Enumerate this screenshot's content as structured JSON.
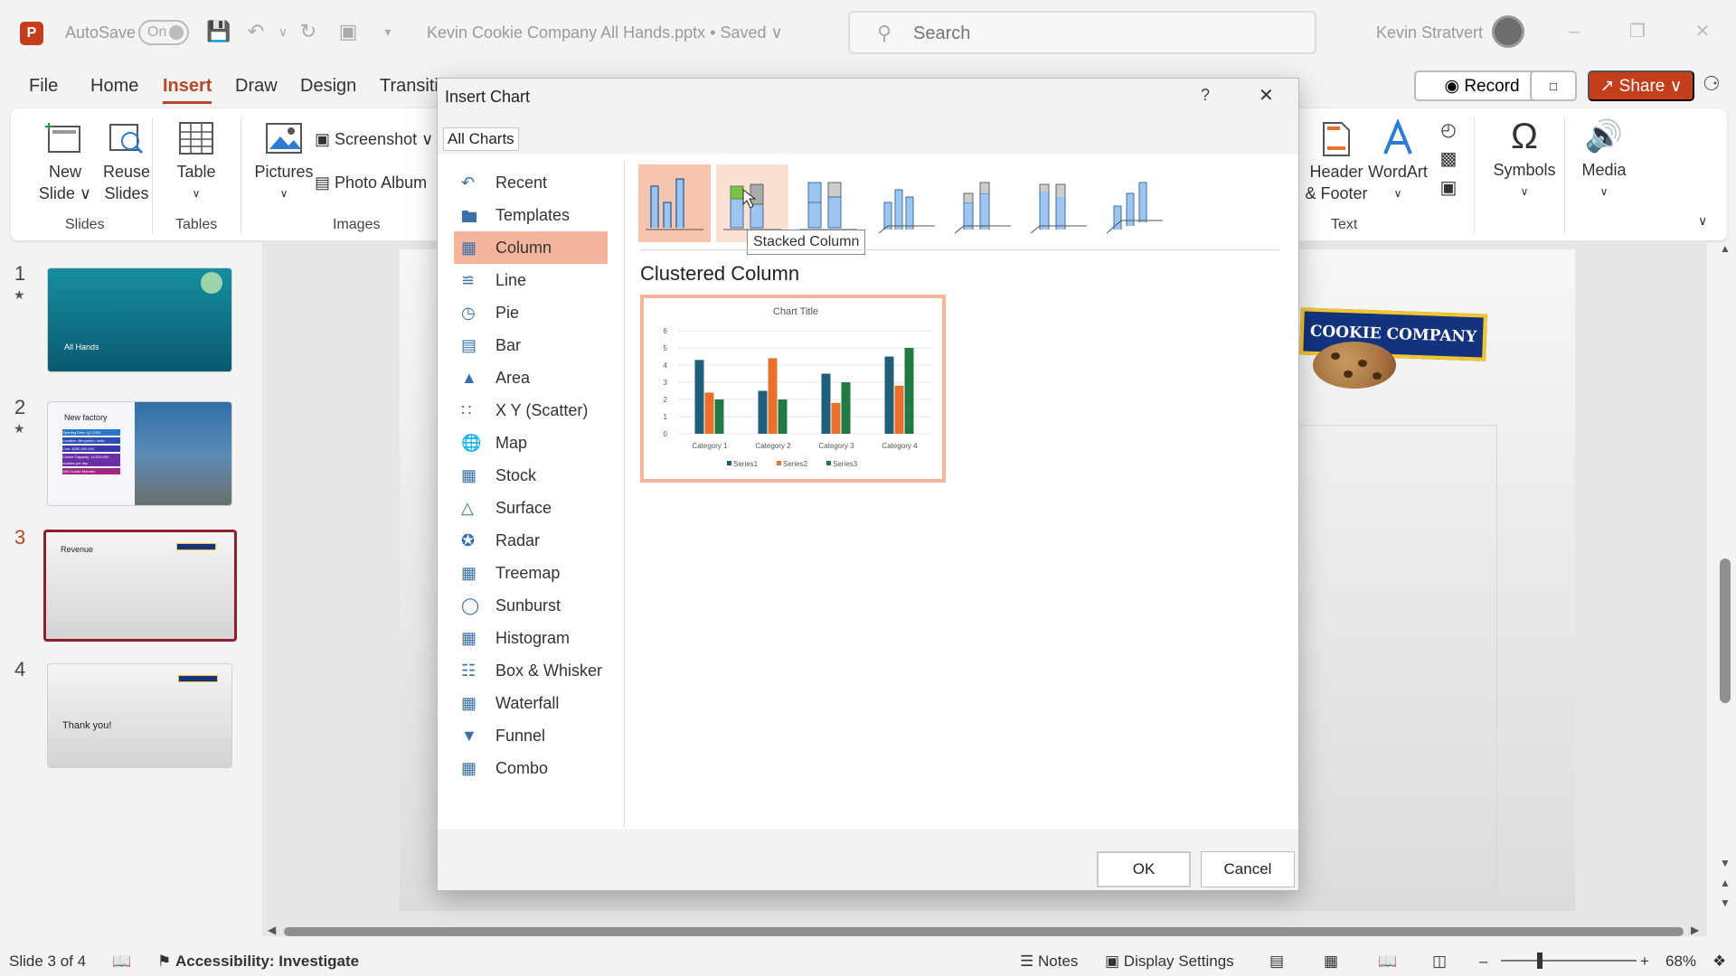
{
  "titlebar": {
    "app_icon": "P",
    "autosave_label": "AutoSave",
    "autosave_state": "On",
    "document_title": "Kevin Cookie Company All Hands.pptx • Saved ∨",
    "search_placeholder": "Search",
    "user_name": "Kevin Stratvert"
  },
  "tabs": [
    "File",
    "Home",
    "Insert",
    "Draw",
    "Design",
    "Transiti"
  ],
  "active_tab": "Insert",
  "right_buttons": {
    "record": "Record",
    "share": "Share"
  },
  "ribbon": {
    "new_slide": "New\nSlide ∨",
    "reuse_slides": "Reuse\nSlides",
    "table": "Table",
    "pictures": "Pictures",
    "screenshot": "Screenshot ∨",
    "photo_album": "Photo Album",
    "header_footer": "Header\n& Footer",
    "wordart": "WordArt",
    "symbols": "Symbols",
    "media": "Media",
    "groups": {
      "slides": "Slides",
      "tables": "Tables",
      "images": "Images",
      "text": "Text"
    }
  },
  "slides": [
    {
      "number": "1",
      "title": "All Hands"
    },
    {
      "number": "2",
      "title": "New factory",
      "items": [
        "Opening Date: Q1 2024",
        "Location: Bengaluru, India",
        "Cost: $250,000,000",
        "Cookie Capacity: 10,000,000 cookies per day",
        "10K Cookie Monster"
      ]
    },
    {
      "number": "3",
      "title": "Revenue"
    },
    {
      "number": "4",
      "title": "Thank you!"
    }
  ],
  "slide_logo_text": "COOKIE COMPANY",
  "statusbar": {
    "slide_count": "Slide 3 of 4",
    "accessibility": "Accessibility: Investigate",
    "notes": "Notes",
    "display_settings": "Display Settings",
    "zoom": "68%"
  },
  "dialog": {
    "title": "Insert Chart",
    "help": "?",
    "tab": "All Charts",
    "chart_types": [
      "Recent",
      "Templates",
      "Column",
      "Line",
      "Pie",
      "Bar",
      "Area",
      "X Y (Scatter)",
      "Map",
      "Stock",
      "Surface",
      "Radar",
      "Treemap",
      "Sunburst",
      "Histogram",
      "Box & Whisker",
      "Waterfall",
      "Funnel",
      "Combo"
    ],
    "selected_type": "Column",
    "tooltip": "Stacked Column",
    "variant_title": "Clustered Column",
    "ok": "OK",
    "cancel": "Cancel"
  },
  "chart_data": {
    "type": "bar",
    "title": "Chart Title",
    "categories": [
      "Category 1",
      "Category 2",
      "Category 3",
      "Category 4"
    ],
    "series": [
      {
        "name": "Series1",
        "values": [
          4.3,
          2.5,
          3.5,
          4.5
        ],
        "color": "#1f5f7a"
      },
      {
        "name": "Series2",
        "values": [
          2.4,
          4.4,
          1.8,
          2.8
        ],
        "color": "#e8702a"
      },
      {
        "name": "Series3",
        "values": [
          2,
          2,
          3,
          5
        ],
        "color": "#217a43"
      }
    ],
    "ylim": [
      0,
      6
    ],
    "yticks": [
      "0",
      "1",
      "2",
      "3",
      "4",
      "5",
      "6"
    ],
    "grid": true,
    "legend": "bottom"
  }
}
